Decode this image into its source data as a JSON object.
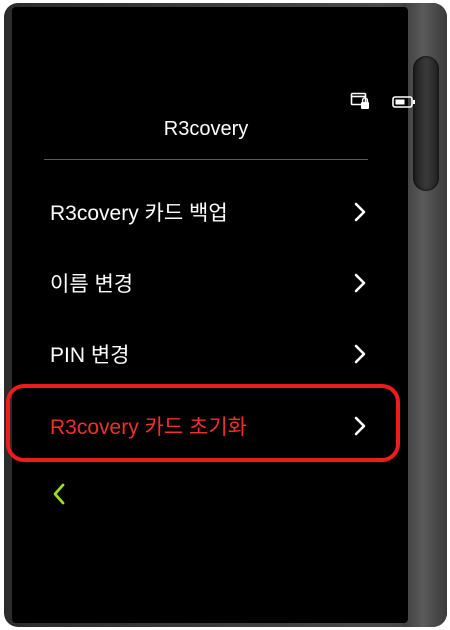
{
  "header": {
    "title": "R3covery"
  },
  "status_icons": [
    "card-lock-icon",
    "battery-icon"
  ],
  "menu": {
    "items": [
      {
        "label": "R3covery 카드 백업",
        "icon": "chevron-right-icon"
      },
      {
        "label": "이름 변경",
        "icon": "chevron-right-icon"
      },
      {
        "label": "PIN 변경",
        "icon": "chevron-right-icon"
      },
      {
        "label": "R3covery 카드 초기화",
        "icon": "chevron-right-icon",
        "color": "#f0302c",
        "highlighted": true
      }
    ]
  },
  "navigation": {
    "back_icon": "chevron-left-icon",
    "back_color": "#9be01a"
  },
  "colors": {
    "screen_background": "#000000",
    "text": "#ffffff",
    "danger": "#f0302c",
    "highlight_border": "#ee1c1c",
    "accent": "#9be01a"
  }
}
